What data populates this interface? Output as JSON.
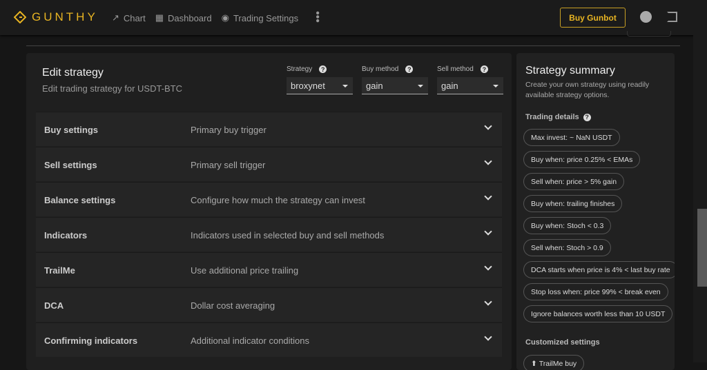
{
  "header": {
    "logo": "GUNTHY",
    "nav": [
      {
        "label": "Chart",
        "icon": "trend-icon"
      },
      {
        "label": "Dashboard",
        "icon": "dashboard-icon"
      },
      {
        "label": "Trading Settings",
        "icon": "settings-icon"
      }
    ],
    "buy_label": "Buy Gunbot"
  },
  "edit": {
    "title": "Edit strategy",
    "subtitle": "Edit trading strategy for USDT-BTC",
    "selects": [
      {
        "label": "Strategy",
        "value": "broxynet"
      },
      {
        "label": "Buy method",
        "value": "gain"
      },
      {
        "label": "Sell method",
        "value": "gain"
      }
    ],
    "sections": [
      {
        "name": "Buy settings",
        "desc": "Primary buy trigger"
      },
      {
        "name": "Sell settings",
        "desc": "Primary sell trigger"
      },
      {
        "name": "Balance settings",
        "desc": "Configure how much the strategy can invest"
      },
      {
        "name": "Indicators",
        "desc": "Indicators used in selected buy and sell methods"
      },
      {
        "name": "TrailMe",
        "desc": "Use additional price trailing"
      },
      {
        "name": "DCA",
        "desc": "Dollar cost averaging"
      },
      {
        "name": "Confirming indicators",
        "desc": "Additional indicator conditions"
      }
    ]
  },
  "summary": {
    "title": "Strategy summary",
    "subtitle": "Create your own strategy using readily available strategy options.",
    "trading_details": "Trading details",
    "chips": [
      "Max invest: ~ NaN USDT",
      "Buy when: price 0.25% < EMAs",
      "Sell when: price > 5% gain",
      "Buy when: trailing finishes",
      "Buy when: Stoch < 0.3",
      "Sell when: Stoch > 0.9",
      "DCA starts when price is 4% < last buy rate",
      "Stop loss when: price 99% < break even",
      "Ignore balances worth less than 10 USDT"
    ],
    "customized": "Customized settings",
    "custom_chip": "TrailMe buy"
  }
}
